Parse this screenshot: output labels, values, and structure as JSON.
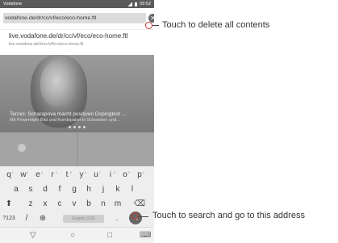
{
  "status_bar": {
    "carrier": "Vodafone",
    "time": "09:52"
  },
  "url_bar": {
    "value": "vodafone.de/dr/cc/vf/eco/eco-home.ftl",
    "clear_icon": "✕"
  },
  "suggestion": {
    "title": "live.vodafone.de/dr/cc/vf/eco/eco-home.ftl",
    "subtitle": "live.vodafone.de/dr/cc/vf/eco/eco-home.ftl"
  },
  "content": {
    "headline": "Tennis: Scharapova macht positiven Dopingtest ...",
    "subline": "Mit Powertriple Bild und Kombipaket in Schweden und..."
  },
  "keyboard": {
    "row1": [
      "q",
      "w",
      "e",
      "r",
      "t",
      "y",
      "u",
      "i",
      "o",
      "p"
    ],
    "row1_hints": [
      "1",
      "2",
      "3",
      "4",
      "5",
      "6",
      "7",
      "8",
      "9",
      "0"
    ],
    "row2": [
      "a",
      "s",
      "d",
      "f",
      "g",
      "h",
      "j",
      "k",
      "l"
    ],
    "row3": [
      "z",
      "x",
      "c",
      "v",
      "b",
      "n",
      "m"
    ],
    "shift_icon": "⬆",
    "backspace_icon": "⌫",
    "sym": "?123",
    "slash": "/",
    "globe_icon": "⊕",
    "space": "English (US)",
    "period": ".",
    "go_icon": "→"
  },
  "navbar": {
    "back_icon": "▽",
    "home_icon": "○",
    "recents_icon": "□",
    "keyboard_icon": "⌨"
  },
  "annotations": {
    "clear": "Touch to delete all contents",
    "go": "Touch to search and go to this address"
  },
  "colors": {
    "callout_ring": "#c0392b"
  }
}
